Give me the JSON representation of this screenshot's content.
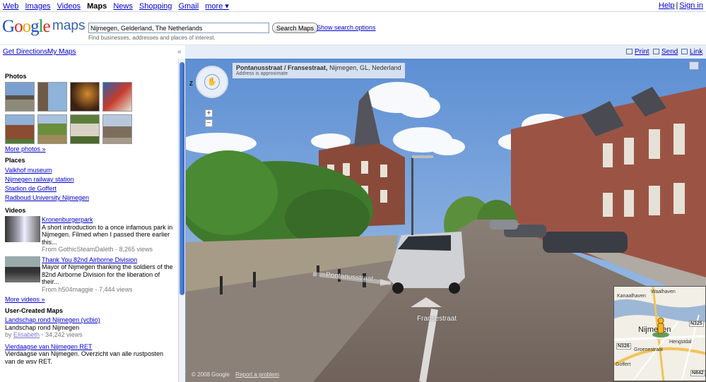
{
  "topnav": {
    "items": [
      "Web",
      "Images",
      "Videos",
      "Maps",
      "News",
      "Shopping",
      "Gmail",
      "more ▾"
    ],
    "current": "Maps",
    "help": "Help",
    "sign_in": "Sign in"
  },
  "header": {
    "logo_word": "Google",
    "product": "maps",
    "search_value": "Nijmegen, Gelderland, The Netherlands",
    "search_button": "Search Maps",
    "search_options": "Show search options",
    "search_hint": "Find businesses, addresses and places of interest."
  },
  "linkbar": {
    "get_directions": "Get Directions",
    "my_maps": "My Maps",
    "collapse": "«",
    "print": "Print",
    "send": "Send",
    "link": "Link"
  },
  "panel": {
    "photos_title": "Photos",
    "more_photos": "More photos »",
    "places_title": "Places",
    "places": [
      "Valkhof museum",
      "Nijmegen railway station",
      "Stadion de Goffert",
      "Radboud University Nijmegen"
    ],
    "videos_title": "Videos",
    "videos": [
      {
        "title": "Kronenburgerpark",
        "desc": "A short introduction to a once infamous park in Nijmegen. Filmed when I passed there earlier this...",
        "meta": "From GothicSteamDaleth - 8,265 views"
      },
      {
        "title": "Thank You 82nd Airborne Division",
        "desc": "Mayor of Nijmegen thanking the soldiers of the 82nd Airborne Division for the liberation of their...",
        "meta": "From h504maggie - 7,444 views"
      }
    ],
    "more_videos": "More videos »",
    "ucm_title": "User-Created Maps",
    "ucm": [
      {
        "title": "Landschap rond Nijmegen (vcbio)",
        "desc": "Landschap rond Nijmegen",
        "by_prefix": "by",
        "author": "Elisabeth",
        "views": "- 34,242 views"
      },
      {
        "title": "Vierdaagse van Nijmegen RET",
        "desc": "Vierdaagse van Nijmegen. Overzicht van alle rustposten van de wsv RET.",
        "by_prefix": "",
        "author": "",
        "views": ""
      }
    ]
  },
  "streetview": {
    "street": "Pontanusstraat / Fransestraat,",
    "locality": "Nijmegen, GL, Nederland",
    "approx": "Address is approximate",
    "label_pontanus": "Pontanusstraat",
    "label_franses": "Fransestraat",
    "zoom_in": "+",
    "zoom_out": "−",
    "z_label": "Z",
    "copyright": "© 2008 Google",
    "report": "Report a problem"
  },
  "minimap": {
    "area_label": "Waalhaven",
    "area_label2": "Kanaalhaven",
    "city": "Nijmegen",
    "roads": [
      "N325",
      "N326",
      "N842"
    ],
    "streets": [
      "Groenestraat",
      "Hengstdal",
      "Goffert"
    ]
  },
  "colors": {
    "link": "#0000cc",
    "sky": "#6d9bd6",
    "brick": "#8a4a3a",
    "tree": "#3f7a2c"
  }
}
